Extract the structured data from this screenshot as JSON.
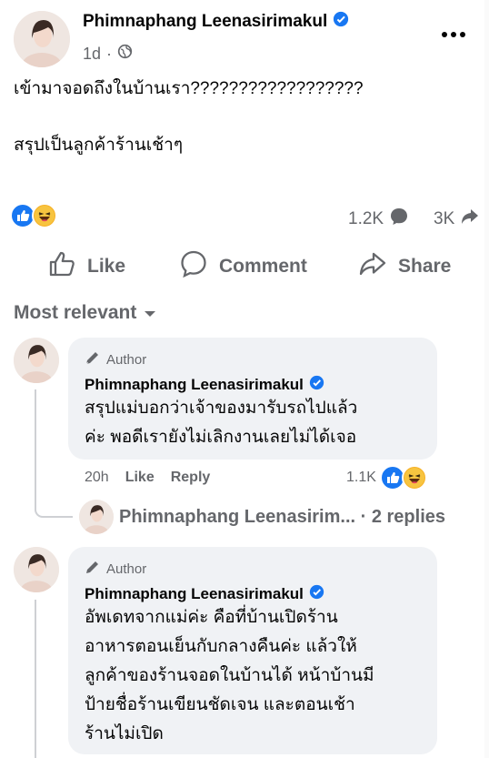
{
  "post": {
    "author": "Phimnaphang Leenasirimakul",
    "time": "1d",
    "time_sep": "·",
    "line1": "เข้ามาจอดถึงในบ้านเรา??????????????????",
    "line2": "สรุปเป็นลูกค้าร้านเช้าๆ",
    "comments_count": "1.2K",
    "shares_count": "3K"
  },
  "actions": {
    "like": "Like",
    "comment": "Comment",
    "share": "Share"
  },
  "sort_label": "Most relevant",
  "comments": [
    {
      "tag": "Author",
      "name": "Phimnaphang Leenasirimakul",
      "lines": [
        "สรุปแม่บอกว่าเจ้าของมารับรถไปแล้ว",
        "ค่ะ พอดีเรายังไม่เลิกงานเลยไม่ได้เจอ"
      ],
      "time": "20h",
      "like": "Like",
      "reply": "Reply",
      "reactions": "1.1K"
    },
    {
      "tag": "Author",
      "name": "Phimnaphang Leenasirimakul",
      "lines": [
        "อัพเดทจากแม่ค่ะ คือที่บ้านเปิดร้าน",
        "อาหารตอนเย็นกับกลางคืนค่ะ แล้วให้",
        "ลูกค้าของร้านจอดในบ้านได้ หน้าบ้านมี",
        "ป้ายชื่อร้านเขียนชัดเจน และตอนเช้า",
        "ร้านไม่เปิด"
      ]
    }
  ],
  "reply_row": {
    "name": "Phimnaphang Leenasirim...",
    "count": "· 2 replies"
  },
  "colors": {
    "like_blue": "#1877f2",
    "haha_yellow": "#f7b125",
    "verified_blue": "#1877f2",
    "muted": "#65676b",
    "bubble": "#f0f2f5"
  },
  "icons": [
    "verified-icon",
    "globe-icon",
    "more-icon",
    "like-reaction-icon",
    "haha-reaction-icon",
    "comment-count-icon",
    "share-count-icon",
    "like-icon",
    "comment-icon",
    "share-icon",
    "caret-down-icon",
    "pen-icon"
  ]
}
